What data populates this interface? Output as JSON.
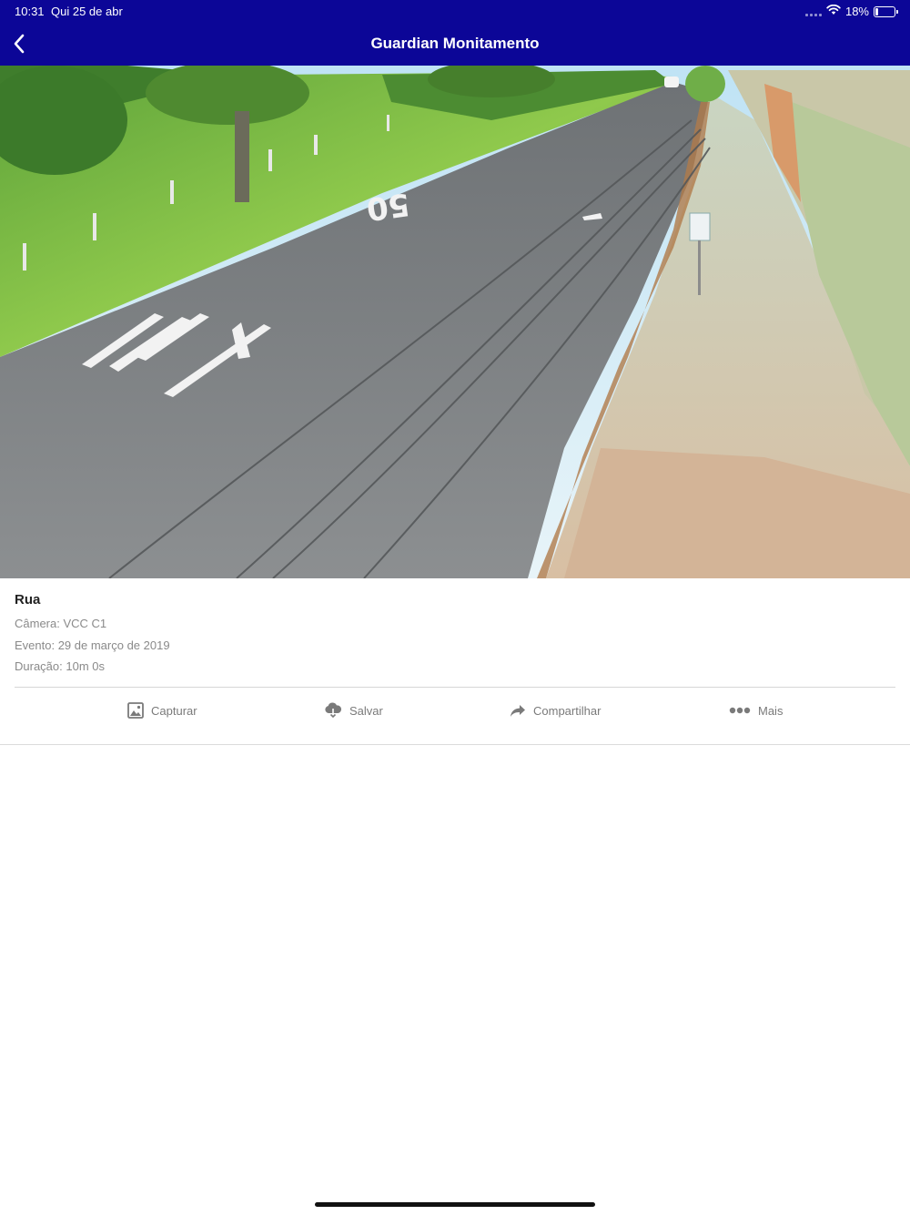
{
  "status_bar": {
    "time": "10:31",
    "date": "Qui 25 de abr",
    "battery": "18%",
    "battery_level": 0.18
  },
  "nav": {
    "back_icon": "chevron-left-icon",
    "title": "Guardian Monitamento"
  },
  "video": {
    "road_marking": "50"
  },
  "event": {
    "title": "Rua",
    "camera": "Câmera: VCC C1",
    "date": "Evento: 29 de março de 2019",
    "duration": "Duração: 10m 0s"
  },
  "actions": [
    {
      "label": "Capturar",
      "icon": "image-icon"
    },
    {
      "label": "Salvar",
      "icon": "cloud-download-icon"
    },
    {
      "label": "Compartilhar",
      "icon": "share-arrow-icon"
    },
    {
      "label": "Mais",
      "icon": "more-dots-icon"
    }
  ],
  "colors": {
    "header_bg": "#0c0697",
    "action_text": "#7a7a7a",
    "meta_text": "#8a8a8a"
  }
}
